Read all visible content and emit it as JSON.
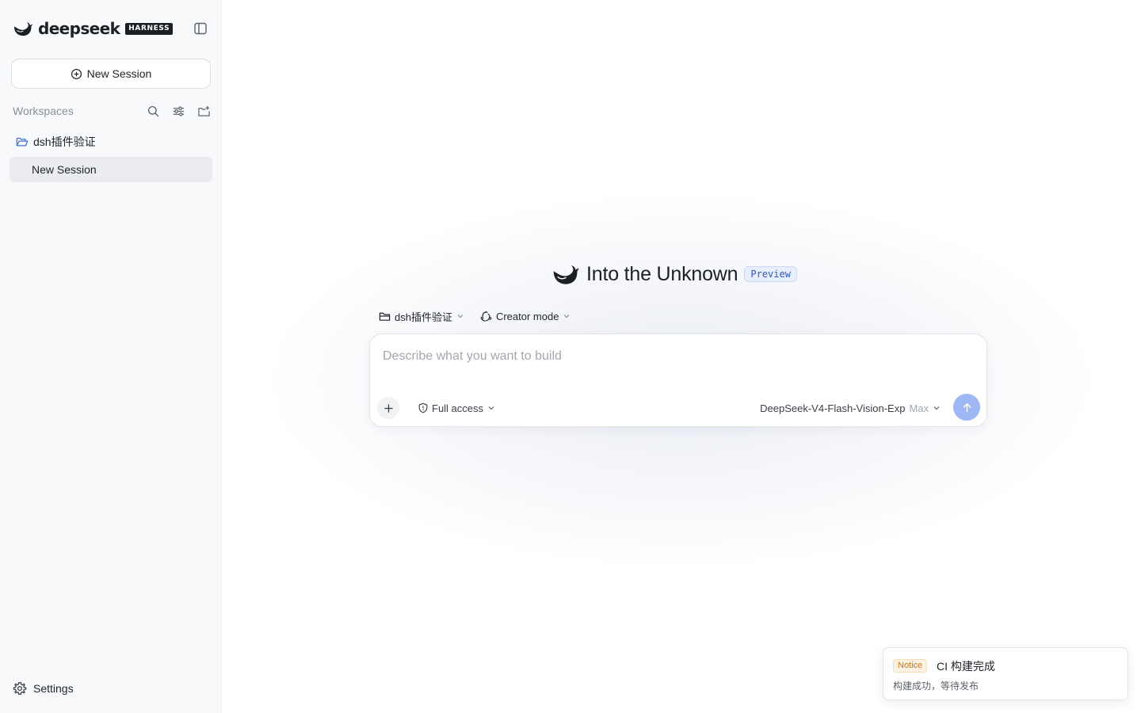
{
  "brand": {
    "name": "deepseek",
    "badge": "HARNESS"
  },
  "sidebar": {
    "new_session_label": "New Session",
    "workspaces_label": "Workspaces",
    "workspace": {
      "name": "dsh插件验证",
      "sessions": [
        {
          "label": "New Session",
          "active": true
        }
      ]
    },
    "settings_label": "Settings"
  },
  "main": {
    "title": "Into the Unknown",
    "badge": "Preview",
    "workspace_selector": "dsh插件验证",
    "mode_selector": "Creator mode",
    "composer": {
      "placeholder": "Describe what you want to build",
      "value": "",
      "access_label": "Full access",
      "model": "DeepSeek-V4-Flash-Vision-Exp",
      "effort": "Max"
    }
  },
  "toast": {
    "badge": "Notice",
    "title": "CI 构建完成",
    "body": "构建成功，等待发布"
  },
  "colors": {
    "accent": "#9db8f4",
    "preview_badge": "#2f55c8",
    "notice": "#c7751b",
    "sidebar_bg": "#f8f9fb",
    "active_item_bg": "#ebecef"
  },
  "icons": {
    "brand": "deepseek-whale-icon",
    "sidebar_toggle": "sidebar-toggle-icon",
    "new_session": "plus-circle-icon",
    "search": "search-icon",
    "filter": "sliders-icon",
    "new_workspace": "folder-plus-icon",
    "workspace": "folder-open-icon",
    "settings": "gear-icon",
    "mode": "recycle-icon",
    "access": "shield-icon",
    "attach": "plus-icon",
    "send": "arrow-up-icon",
    "dropdown": "chevron-down-icon"
  }
}
